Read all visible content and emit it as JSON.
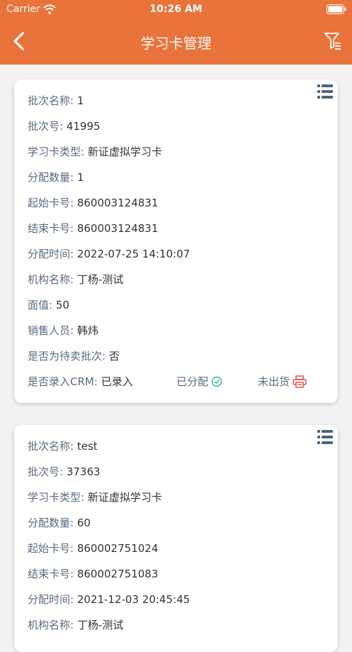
{
  "statusbar": {
    "carrier": "Carrier",
    "time": "10:26 AM"
  },
  "nav": {
    "title": "学习卡管理"
  },
  "cards": [
    {
      "fields": [
        {
          "label": "批次名称:",
          "value": "1"
        },
        {
          "label": "批次号:",
          "value": "41995"
        },
        {
          "label": "学习卡类型:",
          "value": "新证虚拟学习卡"
        },
        {
          "label": "分配数量:",
          "value": "1"
        },
        {
          "label": "起始卡号:",
          "value": "860003124831"
        },
        {
          "label": "结束卡号:",
          "value": "860003124831"
        },
        {
          "label": "分配时间:",
          "value": "2022-07-25 14:10:07"
        },
        {
          "label": "机构名称:",
          "value": "丁杨-测试"
        },
        {
          "label": "面值:",
          "value": "50"
        },
        {
          "label": "销售人员:",
          "value": "韩炜"
        },
        {
          "label": "是否为待卖批次:",
          "value": "否"
        }
      ],
      "crm": {
        "label": "是否录入CRM:",
        "value": "已录入"
      },
      "assigned_label": "已分配",
      "ship_label": "未出货"
    },
    {
      "fields": [
        {
          "label": "批次名称:",
          "value": "test"
        },
        {
          "label": "批次号:",
          "value": "37363"
        },
        {
          "label": "学习卡类型:",
          "value": "新证虚拟学习卡"
        },
        {
          "label": "分配数量:",
          "value": "60"
        },
        {
          "label": "起始卡号:",
          "value": "860002751024"
        },
        {
          "label": "结束卡号:",
          "value": "860002751083"
        },
        {
          "label": "分配时间:",
          "value": "2021-12-03 20:45:45"
        },
        {
          "label": "机构名称:",
          "value": "丁杨-测试"
        }
      ]
    }
  ],
  "colors": {
    "accent": "#e9733a",
    "label": "#5b6a82",
    "assigned": "#2db88b",
    "ship": "#e5473a"
  }
}
